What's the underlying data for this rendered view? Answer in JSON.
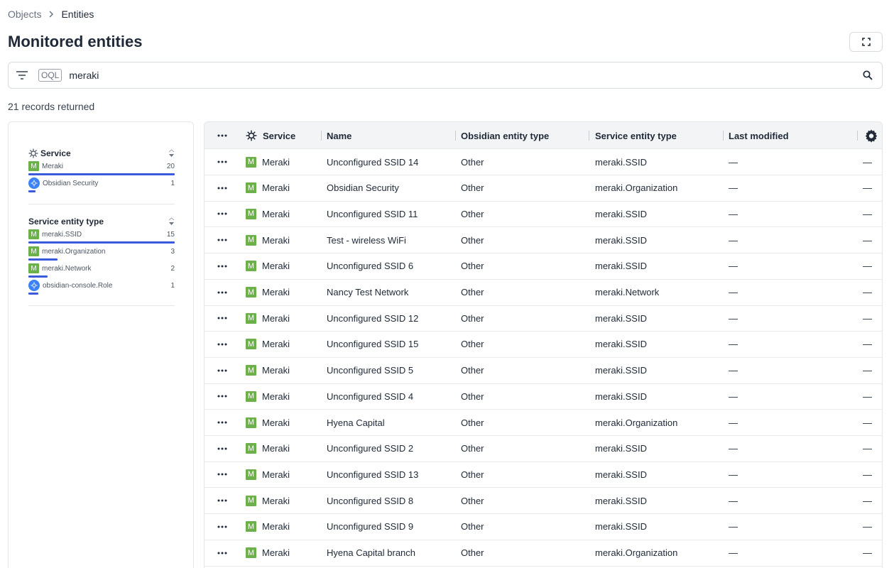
{
  "breadcrumb": {
    "parent": "Objects",
    "current": "Entities"
  },
  "page_title": "Monitored entities",
  "search": {
    "badge": "OQL",
    "value": "meraki"
  },
  "record_count": "21 records returned",
  "colors": {
    "accent_bar": "#3b5bdb",
    "meraki_green": "#6cb04a",
    "obsidian_blue": "#3b82f6"
  },
  "facets": [
    {
      "title": "Service",
      "items": [
        {
          "label": "Meraki",
          "count": "20",
          "icon": "meraki-icon",
          "fraction": 1.0
        },
        {
          "label": "Obsidian Security",
          "count": "1",
          "icon": "obsidian-icon",
          "fraction": 0.05
        }
      ]
    },
    {
      "title": "Service entity type",
      "items": [
        {
          "label": "meraki.SSID",
          "count": "15",
          "icon": "meraki-icon",
          "fraction": 1.0
        },
        {
          "label": "meraki.Organization",
          "count": "3",
          "icon": "meraki-icon",
          "fraction": 0.2
        },
        {
          "label": "meraki.Network",
          "count": "2",
          "icon": "meraki-icon",
          "fraction": 0.133
        },
        {
          "label": "obsidian-console.Role",
          "count": "1",
          "icon": "obsidian-icon",
          "fraction": 0.067
        }
      ]
    }
  ],
  "table": {
    "columns": [
      "Service",
      "Name",
      "Obsidian entity type",
      "Service entity type",
      "Last modified"
    ],
    "rows": [
      {
        "service": "Meraki",
        "name": "Unconfigured SSID 14",
        "obsidian_type": "Other",
        "service_type": "meraki.SSID",
        "last_modified": "—",
        "extra": "—"
      },
      {
        "service": "Meraki",
        "name": "Obsidian Security",
        "obsidian_type": "Other",
        "service_type": "meraki.Organization",
        "last_modified": "—",
        "extra": "—"
      },
      {
        "service": "Meraki",
        "name": "Unconfigured SSID 11",
        "obsidian_type": "Other",
        "service_type": "meraki.SSID",
        "last_modified": "—",
        "extra": "—"
      },
      {
        "service": "Meraki",
        "name": "Test - wireless WiFi",
        "obsidian_type": "Other",
        "service_type": "meraki.SSID",
        "last_modified": "—",
        "extra": "—"
      },
      {
        "service": "Meraki",
        "name": "Unconfigured SSID 6",
        "obsidian_type": "Other",
        "service_type": "meraki.SSID",
        "last_modified": "—",
        "extra": "—"
      },
      {
        "service": "Meraki",
        "name": "Nancy Test Network",
        "obsidian_type": "Other",
        "service_type": "meraki.Network",
        "last_modified": "—",
        "extra": "—"
      },
      {
        "service": "Meraki",
        "name": "Unconfigured SSID 12",
        "obsidian_type": "Other",
        "service_type": "meraki.SSID",
        "last_modified": "—",
        "extra": "—"
      },
      {
        "service": "Meraki",
        "name": "Unconfigured SSID 15",
        "obsidian_type": "Other",
        "service_type": "meraki.SSID",
        "last_modified": "—",
        "extra": "—"
      },
      {
        "service": "Meraki",
        "name": "Unconfigured SSID 5",
        "obsidian_type": "Other",
        "service_type": "meraki.SSID",
        "last_modified": "—",
        "extra": "—"
      },
      {
        "service": "Meraki",
        "name": "Unconfigured SSID 4",
        "obsidian_type": "Other",
        "service_type": "meraki.SSID",
        "last_modified": "—",
        "extra": "—"
      },
      {
        "service": "Meraki",
        "name": "Hyena Capital",
        "obsidian_type": "Other",
        "service_type": "meraki.Organization",
        "last_modified": "—",
        "extra": "—"
      },
      {
        "service": "Meraki",
        "name": "Unconfigured SSID 2",
        "obsidian_type": "Other",
        "service_type": "meraki.SSID",
        "last_modified": "—",
        "extra": "—"
      },
      {
        "service": "Meraki",
        "name": "Unconfigured SSID 13",
        "obsidian_type": "Other",
        "service_type": "meraki.SSID",
        "last_modified": "—",
        "extra": "—"
      },
      {
        "service": "Meraki",
        "name": "Unconfigured SSID 8",
        "obsidian_type": "Other",
        "service_type": "meraki.SSID",
        "last_modified": "—",
        "extra": "—"
      },
      {
        "service": "Meraki",
        "name": "Unconfigured SSID 9",
        "obsidian_type": "Other",
        "service_type": "meraki.SSID",
        "last_modified": "—",
        "extra": "—"
      },
      {
        "service": "Meraki",
        "name": "Hyena Capital branch",
        "obsidian_type": "Other",
        "service_type": "meraki.Organization",
        "last_modified": "—",
        "extra": "—"
      }
    ]
  }
}
